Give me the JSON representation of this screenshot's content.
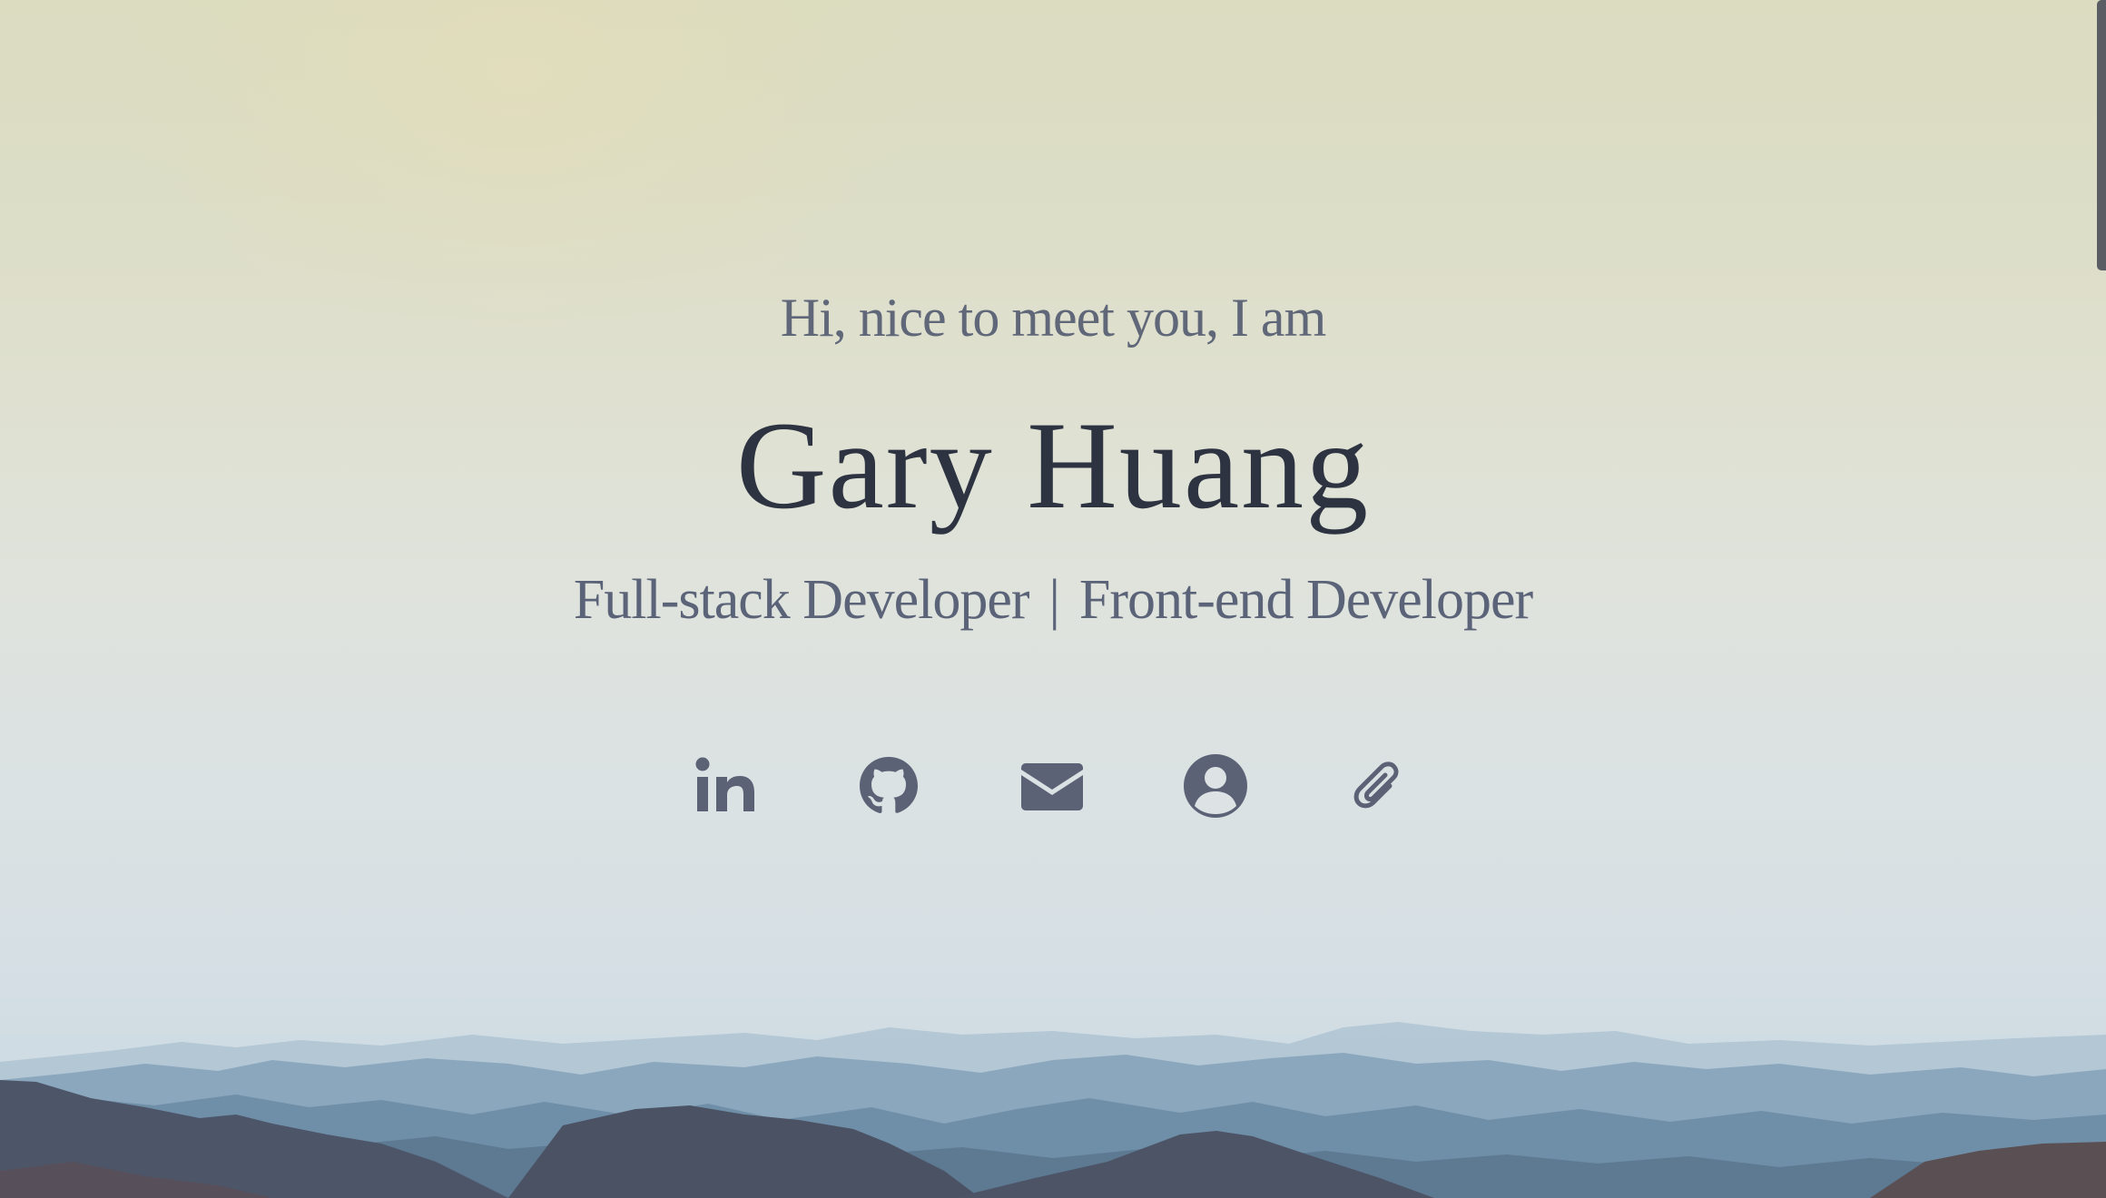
{
  "hero": {
    "greeting": "Hi, nice to meet you, I am",
    "name": "Gary Huang",
    "roles": [
      "Full-stack Developer",
      "Front-end Developer"
    ],
    "role_separator": "|"
  },
  "social_links": [
    {
      "icon": "linkedin-icon",
      "label": "LinkedIn"
    },
    {
      "icon": "github-icon",
      "label": "GitHub"
    },
    {
      "icon": "envelope-icon",
      "label": "Email"
    },
    {
      "icon": "user-circle-icon",
      "label": "About"
    },
    {
      "icon": "paperclip-icon",
      "label": "Resume"
    }
  ],
  "colors": {
    "name": "#2d3340",
    "text": "#5f6779",
    "icons": "#5b6276",
    "sky_top": "#dbdcc0",
    "sky_bottom": "#c9d7e0"
  }
}
